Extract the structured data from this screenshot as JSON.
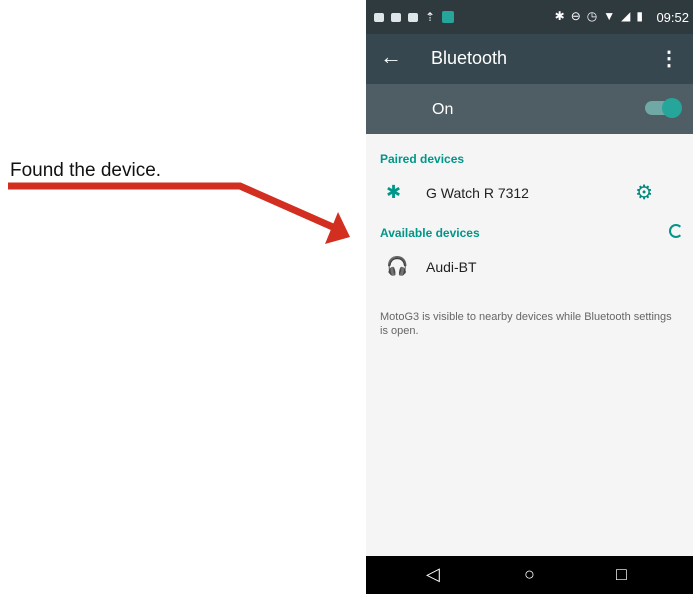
{
  "annotation": {
    "text": "Found the device."
  },
  "status_bar": {
    "time": "09:52"
  },
  "app_bar": {
    "back_icon": "←",
    "title": "Bluetooth",
    "menu_icon": "⋮"
  },
  "on_row": {
    "label": "On"
  },
  "sections": {
    "paired": "Paired devices",
    "available": "Available devices"
  },
  "paired_devices": [
    {
      "name": "G Watch R 7312",
      "icon": "bluetooth-icon"
    }
  ],
  "available_devices": [
    {
      "name": "Audi-BT",
      "icon": "headphones-icon"
    }
  ],
  "visibility_text": "MotoG3 is visible to nearby devices while Bluetooth settings is open.",
  "nav": {
    "back": "◁",
    "home": "○",
    "recents": "□"
  },
  "colors": {
    "accent": "#009688",
    "appbar": "#37474f",
    "arrow": "#d22f20"
  }
}
